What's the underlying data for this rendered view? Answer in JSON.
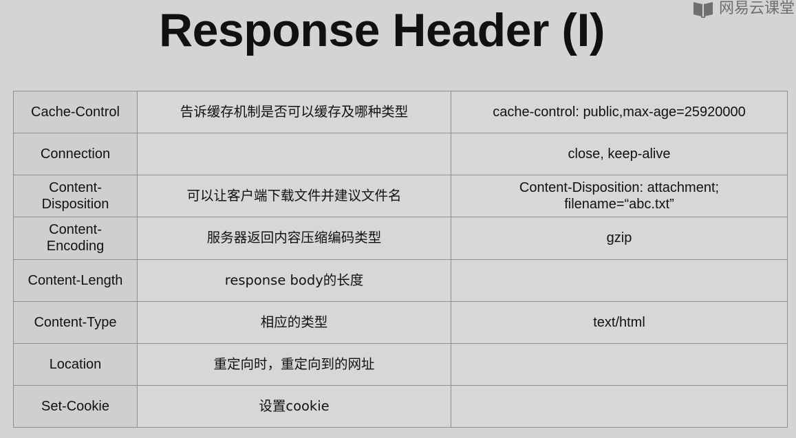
{
  "slide": {
    "title": "Response Header (I)"
  },
  "watermark": {
    "label": "网易云课堂",
    "icon": "book-logo-icon"
  },
  "table": {
    "rows": [
      {
        "header": "Cache-Control",
        "description": "告诉缓存机制是否可以缓存及哪种类型",
        "example": "cache-control: public,max-age=25920000"
      },
      {
        "header": "Connection",
        "description": "",
        "example": "close, keep-alive"
      },
      {
        "header": "Content-\nDisposition",
        "description": "可以让客户端下载文件并建议文件名",
        "example": "Content-Disposition: attachment;\nfilename=“abc.txt”"
      },
      {
        "header": "Content-\nEncoding",
        "description": "服务器返回内容压缩编码类型",
        "example": "gzip"
      },
      {
        "header": "Content-Length",
        "description": "response body的长度",
        "example": ""
      },
      {
        "header": "Content-Type",
        "description": "相应的类型",
        "example": "text/html"
      },
      {
        "header": "Location",
        "description": "重定向时，重定向到的网址",
        "example": ""
      },
      {
        "header": "Set-Cookie",
        "description": "设置cookie",
        "example": ""
      }
    ]
  }
}
